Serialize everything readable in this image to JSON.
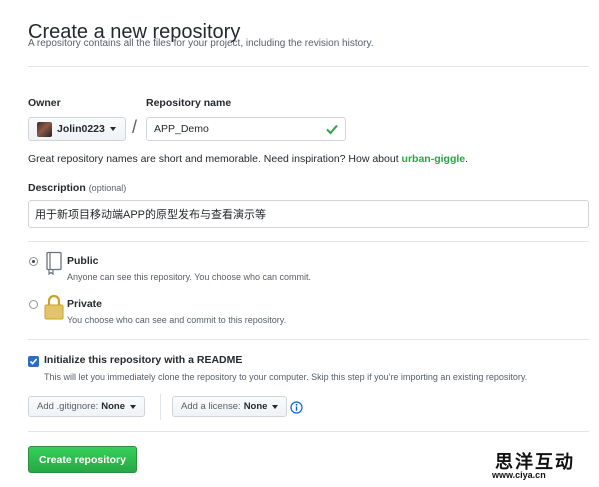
{
  "header": {
    "title": "Create a new repository",
    "subtitle": "A repository contains all the files for your project, including the revision history."
  },
  "owner": {
    "label": "Owner",
    "value": "Jolin0223"
  },
  "repository": {
    "label": "Repository name",
    "value": "APP_Demo",
    "valid": true
  },
  "hint": {
    "text": "Great repository names are short and memorable. Need inspiration? How about ",
    "suggestion": "urban-giggle",
    "end": "."
  },
  "description": {
    "label": "Description",
    "optional": "(optional)",
    "value": "用于新项目移动端APP的原型发布与查看演示等"
  },
  "visibility": {
    "selected": "public",
    "public": {
      "title": "Public",
      "desc": "Anyone can see this repository. You choose who can commit."
    },
    "private": {
      "title": "Private",
      "desc": "You choose who can see and commit to this repository."
    }
  },
  "readme": {
    "checked": true,
    "label": "Initialize this repository with a README",
    "desc": "This will let you immediately clone the repository to your computer. Skip this step if you're importing an existing repository."
  },
  "gitignore": {
    "prefix": "Add .gitignore:",
    "value": "None"
  },
  "license": {
    "prefix": "Add a license:",
    "value": "None"
  },
  "submit": {
    "label": "Create repository"
  },
  "watermark": {
    "text": "思洋互动",
    "url": "www.ciya.cn"
  },
  "colors": {
    "accent_green": "#28a745",
    "link_blue": "#0366d6",
    "checkbox_blue": "#2d6bc8"
  }
}
